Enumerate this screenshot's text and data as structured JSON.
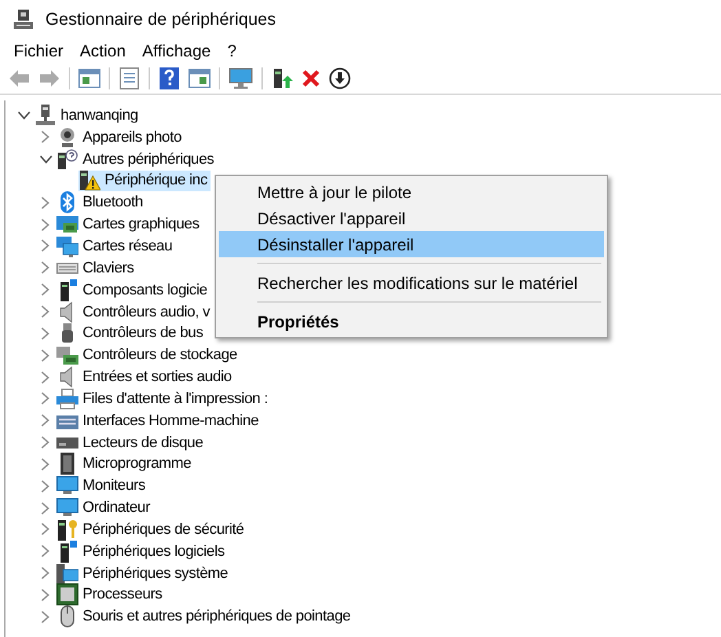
{
  "window": {
    "title": "Gestionnaire de périphériques"
  },
  "menu_bar": [
    "Fichier",
    "Action",
    "Affichage",
    "?"
  ],
  "tree": {
    "label": "hanwanqing",
    "kind": "computer",
    "expanded": true,
    "selected": false,
    "children": [
      {
        "label": "Appareils photo",
        "kind": "webcam",
        "expanded": false,
        "selected": false
      },
      {
        "label": "Autres périphériques",
        "kind": "unknown-device",
        "expanded": true,
        "selected": false,
        "children": [
          {
            "label": "Périphérique inc",
            "kind": "warning-device",
            "selected": true
          }
        ]
      },
      {
        "label": "Bluetooth",
        "kind": "bluetooth",
        "expanded": false,
        "selected": false
      },
      {
        "label": "Cartes graphiques",
        "kind": "graphics-card",
        "expanded": false,
        "selected": false
      },
      {
        "label": "Cartes réseau",
        "kind": "network",
        "expanded": false,
        "selected": false
      },
      {
        "label": "Claviers",
        "kind": "keyboard",
        "expanded": false,
        "selected": false
      },
      {
        "label": "Composants logicie",
        "kind": "software",
        "expanded": false,
        "selected": false
      },
      {
        "label": "Contrôleurs audio, v",
        "kind": "speaker",
        "expanded": false,
        "selected": false
      },
      {
        "label": "Contrôleurs de bus",
        "kind": "usb",
        "expanded": false,
        "selected": false
      },
      {
        "label": "Contrôleurs de stockage",
        "kind": "storage",
        "expanded": false,
        "selected": false
      },
      {
        "label": "Entrées et sorties audio",
        "kind": "speaker",
        "expanded": false,
        "selected": false
      },
      {
        "label": "Files d'attente à l'impression :",
        "kind": "printer",
        "expanded": false,
        "selected": false
      },
      {
        "label": "Interfaces Homme-machine",
        "kind": "hid",
        "expanded": false,
        "selected": false
      },
      {
        "label": "Lecteurs de disque",
        "kind": "disk",
        "expanded": false,
        "selected": false
      },
      {
        "label": "Microprogramme",
        "kind": "firmware",
        "expanded": false,
        "selected": false
      },
      {
        "label": "Moniteurs",
        "kind": "monitor",
        "expanded": false,
        "selected": false
      },
      {
        "label": "Ordinateur",
        "kind": "monitor",
        "expanded": false,
        "selected": false
      },
      {
        "label": "Périphériques de sécurité",
        "kind": "security",
        "expanded": false,
        "selected": false
      },
      {
        "label": "Périphériques logiciels",
        "kind": "software",
        "expanded": false,
        "selected": false
      },
      {
        "label": "Périphériques système",
        "kind": "system",
        "expanded": false,
        "selected": false
      },
      {
        "label": "Processeurs",
        "kind": "processor",
        "expanded": false,
        "selected": false
      },
      {
        "label": "Souris et autres périphériques de pointage",
        "kind": "mouse",
        "expanded": false,
        "selected": false
      }
    ]
  },
  "context_menu": [
    {
      "kind": "item",
      "label": "Mettre à jour le pilote",
      "selected": false,
      "default": false
    },
    {
      "kind": "item",
      "label": "Désactiver l'appareil",
      "selected": false,
      "default": false
    },
    {
      "kind": "item",
      "label": "Désinstaller l'appareil",
      "selected": true,
      "default": false
    },
    {
      "kind": "separator"
    },
    {
      "kind": "item",
      "label": "Rechercher les modifications sur le matériel",
      "selected": false,
      "default": false
    },
    {
      "kind": "separator"
    },
    {
      "kind": "item",
      "label": "Propriétés",
      "selected": false,
      "default": true
    }
  ]
}
